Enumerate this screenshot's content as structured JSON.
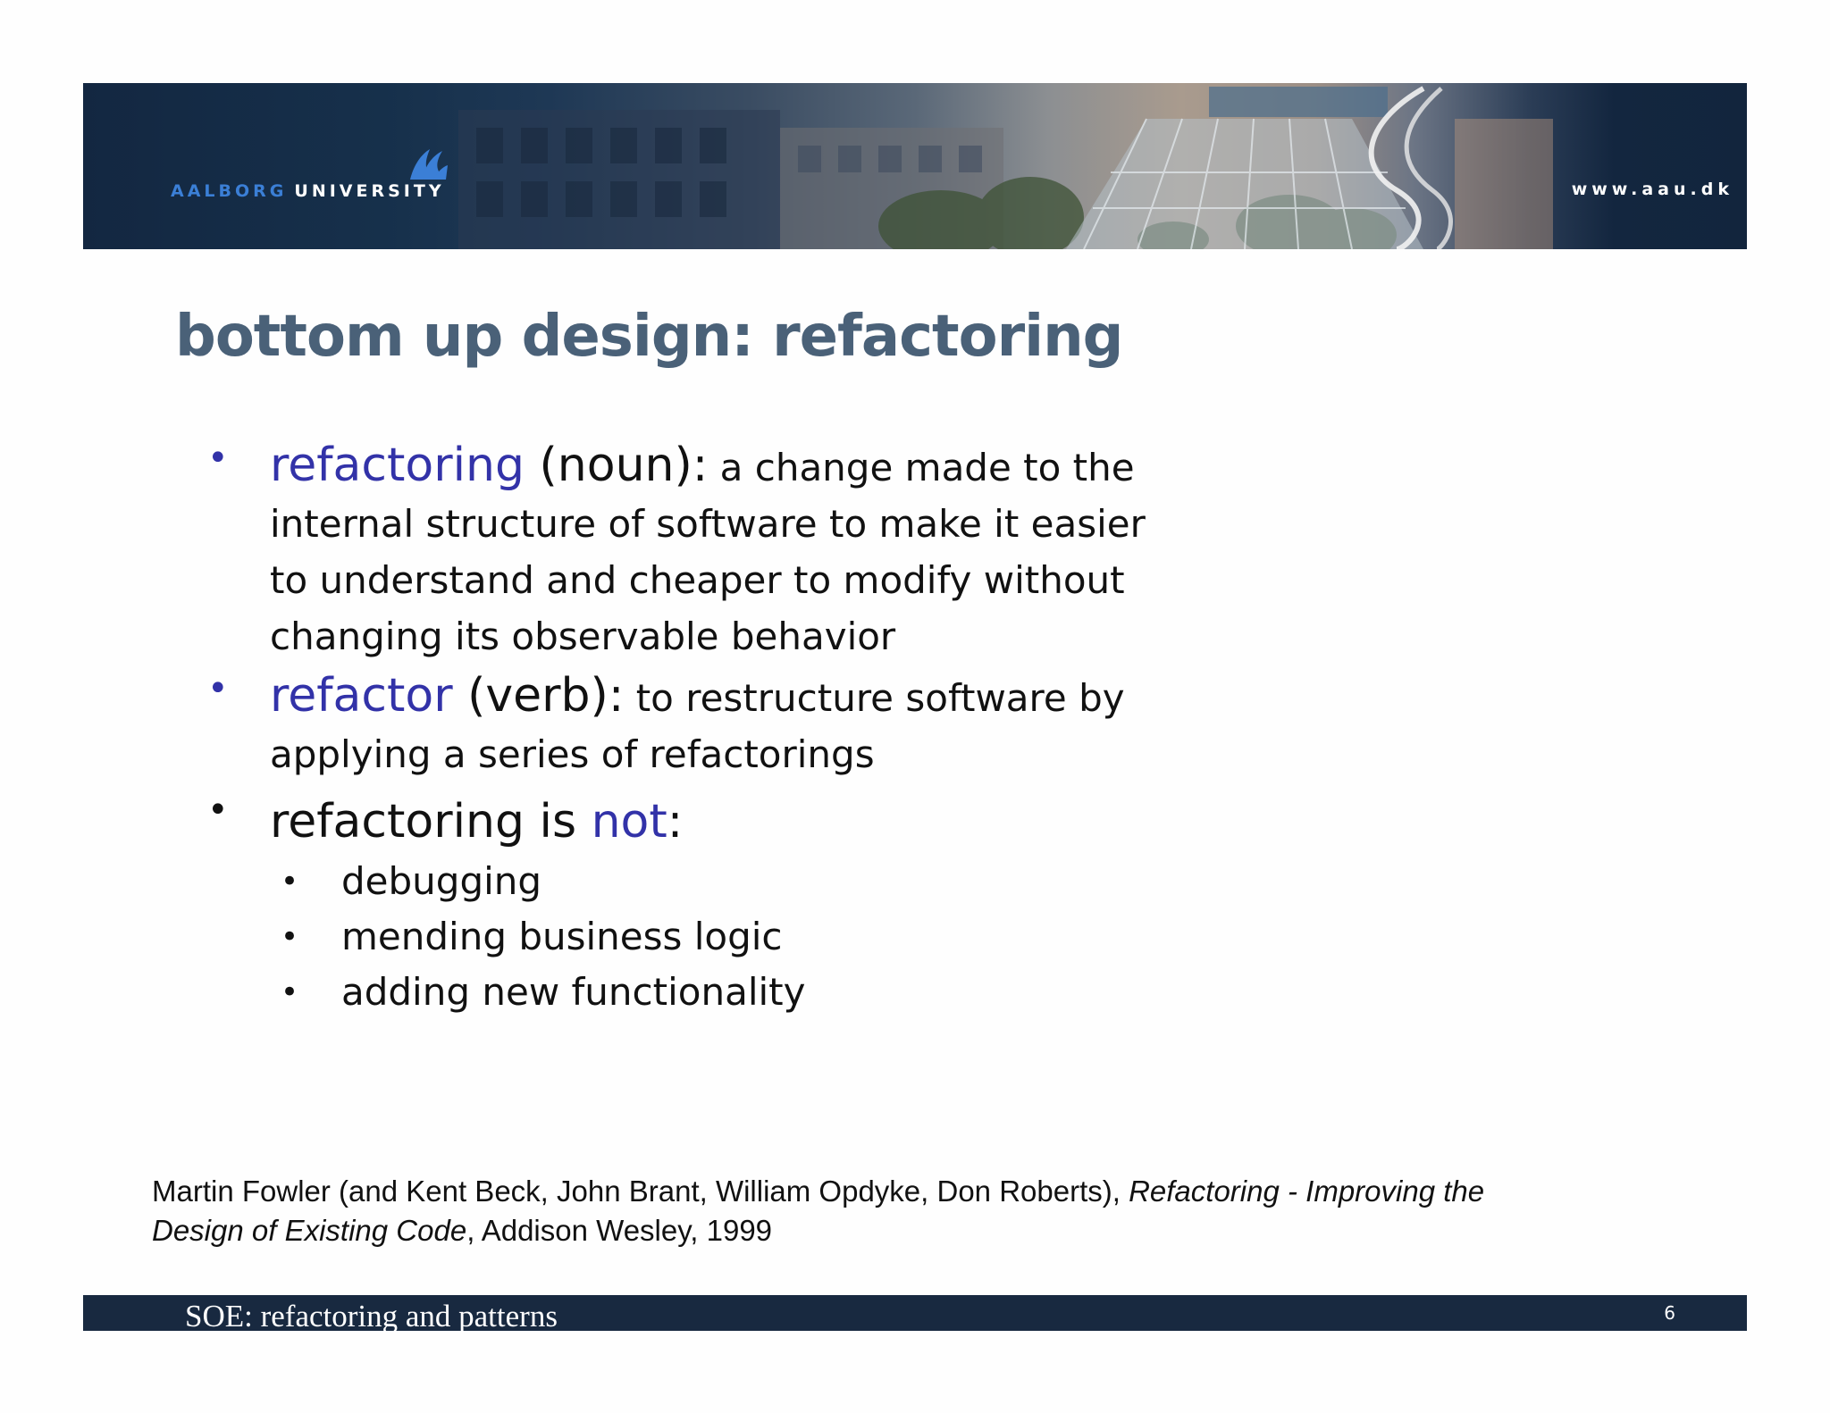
{
  "header": {
    "logo_part1": "AALBORG",
    "logo_part2": "UNIVERSITY",
    "url": "www.aau.dk"
  },
  "slide": {
    "title": "bottom up design: refactoring",
    "bullets": {
      "b1_term": "refactoring",
      "b1_kind": " (noun):",
      "b1_def_line1": " a change made to the",
      "b1_def_line2": "internal structure of software to make it easier",
      "b1_def_line3": "to understand and cheaper to modify without",
      "b1_def_line4": "changing its observable behavior",
      "b2_term": "refactor",
      "b2_kind": " (verb):",
      "b2_def_line1": " to restructure software by",
      "b2_def_line2": "applying a series of refactorings",
      "b3_lead": "refactoring is ",
      "b3_not": "not",
      "b3_colon": ":",
      "sub_items": [
        "debugging",
        "mending business logic",
        "adding new functionality"
      ]
    },
    "bullet_symbol": "•"
  },
  "citation": {
    "authors": "Martin Fowler (and Kent Beck, John Brant, William Opdyke, Don Roberts),  ",
    "book_title_line1": "Refactoring - Improving the",
    "book_title_line2": "Design of Existing Code",
    "publisher": ", Addison Wesley, 1999"
  },
  "footer": {
    "course": "SOE: refactoring and patterns",
    "page_number": "6"
  },
  "colors": {
    "banner_dark": "#132741",
    "title": "#4a6178",
    "accent_term": "#3232a8",
    "logo_blue": "#3b7fd6",
    "footer_bg": "#182940"
  }
}
